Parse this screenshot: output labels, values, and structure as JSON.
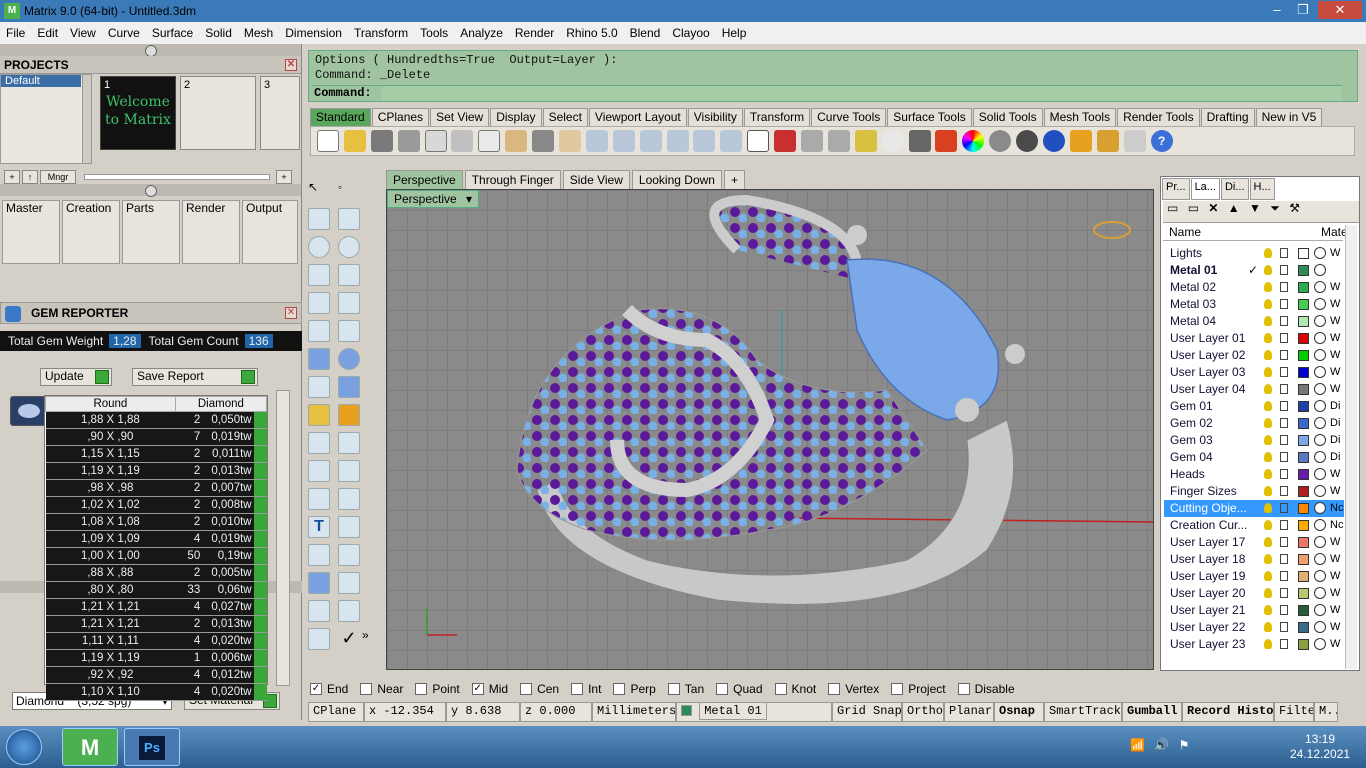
{
  "window": {
    "title": "Matrix 9.0 (64-bit) - Untitled.3dm"
  },
  "menu": [
    "File",
    "Edit",
    "View",
    "Curve",
    "Surface",
    "Solid",
    "Mesh",
    "Dimension",
    "Transform",
    "Tools",
    "Analyze",
    "Render",
    "Rhino 5.0",
    "Blend",
    "Clayoo",
    "Help"
  ],
  "projects": {
    "title": "PROJECTS",
    "default_label": "Default",
    "thumbs": [
      "1",
      "2",
      "3"
    ],
    "welcome": "Welcome to Matrix",
    "mngr": "Mngr"
  },
  "categories": [
    "Master",
    "Creation",
    "Parts",
    "Render",
    "Output"
  ],
  "gem_reporter": {
    "title": "GEM REPORTER",
    "weight_label": "Total Gem Weight",
    "weight": "1,28",
    "count_label": "Total Gem Count",
    "count": "136",
    "update": "Update",
    "save": "Save Report",
    "col_shape": "Round",
    "col_material": "Diamond",
    "rows": [
      [
        "1,88 X 1,88",
        "2",
        "0,050tw"
      ],
      [
        ",90 X ,90",
        "7",
        "0,019tw"
      ],
      [
        "1,15 X 1,15",
        "2",
        "0,011tw"
      ],
      [
        "1,19 X 1,19",
        "2",
        "0,013tw"
      ],
      [
        ",98 X ,98",
        "2",
        "0,007tw"
      ],
      [
        "1,02 X 1,02",
        "2",
        "0,008tw"
      ],
      [
        "1,08 X 1,08",
        "2",
        "0,010tw"
      ],
      [
        "1,09 X 1,09",
        "4",
        "0,019tw"
      ],
      [
        "1,00 X 1,00",
        "50",
        "0,19tw"
      ],
      [
        ",88 X ,88",
        "2",
        "0,005tw"
      ],
      [
        ",80 X ,80",
        "33",
        "0,06tw"
      ],
      [
        "1,21 X 1,21",
        "4",
        "0,027tw"
      ],
      [
        "1,21 X 1,21",
        "2",
        "0,013tw"
      ],
      [
        "1,11 X 1,11",
        "4",
        "0,020tw"
      ],
      [
        "1,19 X 1,19",
        "1",
        "0,006tw"
      ],
      [
        ",92 X ,92",
        "4",
        "0,012tw"
      ],
      [
        "1,10 X 1,10",
        "4",
        "0,020tw"
      ]
    ],
    "material_select": "Diamond    (3,52 spg)",
    "set_material": "Set Material"
  },
  "command": {
    "line1": "Options ( Hundredths=True  Output=Layer ):",
    "line2": "Command: _Delete",
    "prompt": "Command:"
  },
  "toolbar_tabs": [
    "Standard",
    "CPlanes",
    "Set View",
    "Display",
    "Select",
    "Viewport Layout",
    "Visibility",
    "Transform",
    "Curve Tools",
    "Surface Tools",
    "Solid Tools",
    "Mesh Tools",
    "Render Tools",
    "Drafting",
    "New in V5"
  ],
  "viewport_tabs": [
    "Perspective",
    "Through Finger",
    "Side View",
    "Looking Down",
    "+"
  ],
  "viewport_label": "Perspective",
  "right_tabs": [
    "Pr...",
    "La...",
    "Di...",
    "H..."
  ],
  "layers_header": {
    "name": "Name",
    "mat": "Mater"
  },
  "layers": [
    {
      "name": "Lights",
      "color": "#ffffff",
      "mat": "W"
    },
    {
      "name": "Metal 01",
      "color": "#2e8b57",
      "mat": "",
      "current": "✓"
    },
    {
      "name": "Metal 02",
      "color": "#2eaa50",
      "mat": "W"
    },
    {
      "name": "Metal 03",
      "color": "#44cc55",
      "mat": "W"
    },
    {
      "name": "Metal 04",
      "color": "#aee8b0",
      "mat": "W"
    },
    {
      "name": "User Layer 01",
      "color": "#dd0000",
      "mat": "W"
    },
    {
      "name": "User Layer 02",
      "color": "#00cc00",
      "mat": "W"
    },
    {
      "name": "User Layer 03",
      "color": "#0000cc",
      "mat": "W"
    },
    {
      "name": "User Layer 04",
      "color": "#777777",
      "mat": "W"
    },
    {
      "name": "Gem 01",
      "color": "#1f3fa8",
      "mat": "Di"
    },
    {
      "name": "Gem 02",
      "color": "#3a6ad0",
      "mat": "Di"
    },
    {
      "name": "Gem 03",
      "color": "#7fa8e8",
      "mat": "Di"
    },
    {
      "name": "Gem 04",
      "color": "#5a7ac0",
      "mat": "Di"
    },
    {
      "name": "Heads",
      "color": "#6a1aa8",
      "mat": "W"
    },
    {
      "name": "Finger Sizes",
      "color": "#b02020",
      "mat": "W"
    },
    {
      "name": "Cutting Obje...",
      "color": "#ff8800",
      "mat": "Nc"
    },
    {
      "name": "Creation Cur...",
      "color": "#ffaa00",
      "mat": "Nc"
    },
    {
      "name": "User Layer 17",
      "color": "#ee7766",
      "mat": "W"
    },
    {
      "name": "User Layer 18",
      "color": "#f0a070",
      "mat": "W"
    },
    {
      "name": "User Layer 19",
      "color": "#e0b070",
      "mat": "W"
    },
    {
      "name": "User Layer 20",
      "color": "#b8c870",
      "mat": "W"
    },
    {
      "name": "User Layer 21",
      "color": "#2a5a3a",
      "mat": "W"
    },
    {
      "name": "User Layer 22",
      "color": "#3a6a8a",
      "mat": "W"
    },
    {
      "name": "User Layer 23",
      "color": "#8aa040",
      "mat": "W"
    }
  ],
  "osnaps": [
    {
      "label": "End",
      "on": true
    },
    {
      "label": "Near",
      "on": false
    },
    {
      "label": "Point",
      "on": false
    },
    {
      "label": "Mid",
      "on": true
    },
    {
      "label": "Cen",
      "on": false
    },
    {
      "label": "Int",
      "on": false
    },
    {
      "label": "Perp",
      "on": false
    },
    {
      "label": "Tan",
      "on": false
    },
    {
      "label": "Quad",
      "on": false
    },
    {
      "label": "Knot",
      "on": false
    },
    {
      "label": "Vertex",
      "on": false
    },
    {
      "label": "Project",
      "on": false
    },
    {
      "label": "Disable",
      "on": false
    }
  ],
  "status": {
    "cplane": "CPlane",
    "x": "x -12.354",
    "y": "y 8.638",
    "z": "z 0.000",
    "units": "Millimeters",
    "layer": "Metal 01",
    "panes": [
      "Grid Snap",
      "Ortho",
      "Planar",
      "Osnap",
      "SmartTrack",
      "Gumball",
      "Record Histo",
      "Filte",
      "M..."
    ]
  },
  "taskbar": {
    "time": "13:19",
    "date": "24.12.2021"
  }
}
